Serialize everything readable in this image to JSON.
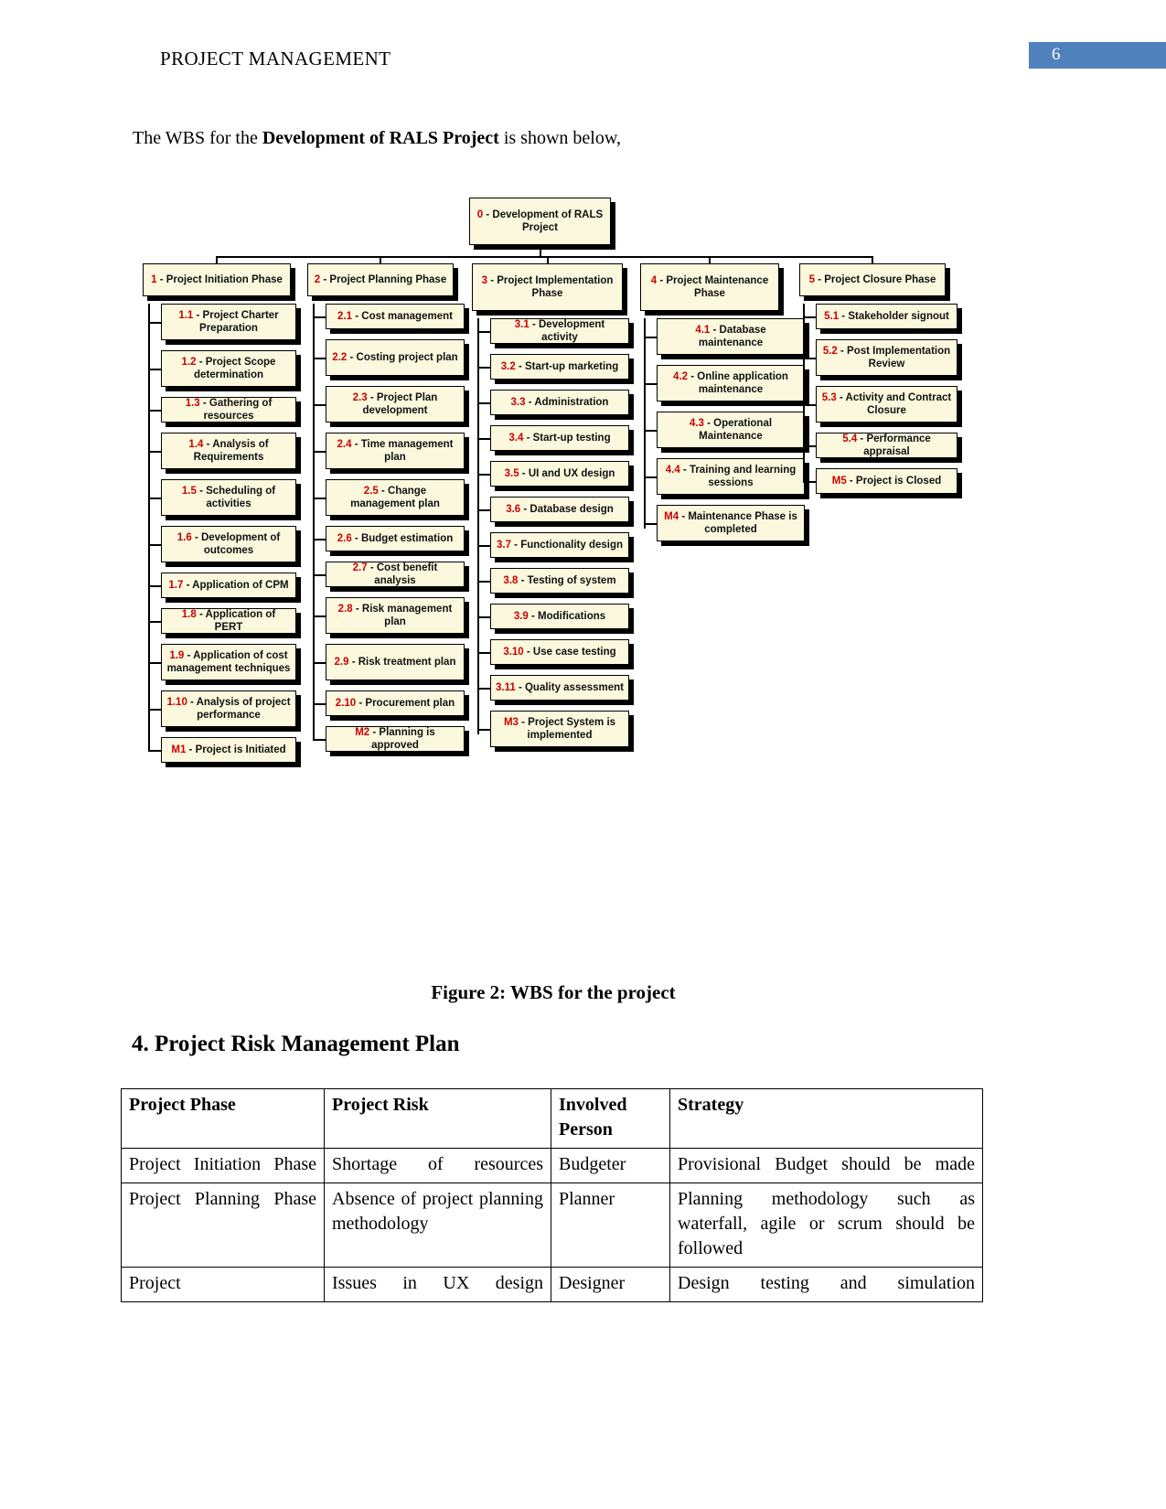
{
  "header": {
    "title": "PROJECT MANAGEMENT",
    "page_number": "6",
    "accent_color": "#4f81bd"
  },
  "intro": {
    "prefix": "The WBS for the ",
    "bold": "Development of RALS Project",
    "suffix": " is shown below,"
  },
  "figure": {
    "caption": "Figure 2: WBS for the project",
    "node_fill_color": "#fbf8dd",
    "code_color": "#cc0000"
  },
  "wbs": {
    "root": {
      "code": "0",
      "label": "- Development of RALS Project"
    },
    "columns": [
      {
        "phase": {
          "code": "1",
          "label": "- Project Initiation Phase"
        },
        "children": [
          {
            "code": "1.1",
            "label": "- Project Charter Preparation"
          },
          {
            "code": "1.2",
            "label": "- Project Scope determination"
          },
          {
            "code": "1.3",
            "label": "- Gathering of resources"
          },
          {
            "code": "1.4",
            "label": "   - Analysis of Requirements"
          },
          {
            "code": "1.5",
            "label": "- Scheduling of activities"
          },
          {
            "code": "1.6",
            "label": "- Development of outcomes"
          },
          {
            "code": "1.7",
            "label": "- Application of CPM"
          },
          {
            "code": "1.8",
            "label": "- Application of PERT"
          },
          {
            "code": "1.9",
            "label": "    - Application of cost management techniques"
          },
          {
            "code": "1.10",
            "label": "- Analysis of project performance"
          },
          {
            "code": "M1",
            "label": "- Project is Initiated"
          }
        ]
      },
      {
        "phase": {
          "code": "2",
          "label": "- Project Planning Phase"
        },
        "children": [
          {
            "code": "2.1",
            "label": "- Cost management"
          },
          {
            "code": "2.2",
            "label": "- Costing project plan"
          },
          {
            "code": "2.3",
            "label": "- Project Plan development"
          },
          {
            "code": "2.4",
            "label": "- Time management plan"
          },
          {
            "code": "2.5",
            "label": "- Change management plan"
          },
          {
            "code": "2.6",
            "label": "- Budget estimation"
          },
          {
            "code": "2.7",
            "label": "- Cost benefit analysis"
          },
          {
            "code": "2.8",
            "label": "- Risk management plan"
          },
          {
            "code": "2.9",
            "label": "- Risk treatment plan"
          },
          {
            "code": "2.10",
            "label": "- Procurement plan"
          },
          {
            "code": "M2",
            "label": "- Planning is approved"
          }
        ]
      },
      {
        "phase": {
          "code": "3",
          "label": "- Project Implementation Phase"
        },
        "children": [
          {
            "code": "3.1",
            "label": "- Development activity"
          },
          {
            "code": "3.2",
            "label": "- Start-up marketing"
          },
          {
            "code": "3.3",
            "label": "- Administration"
          },
          {
            "code": "3.4",
            "label": "- Start-up testing"
          },
          {
            "code": "3.5",
            "label": "- UI and UX design"
          },
          {
            "code": "3.6",
            "label": "- Database design"
          },
          {
            "code": "3.7",
            "label": "- Functionality design"
          },
          {
            "code": "3.8",
            "label": "- Testing of system"
          },
          {
            "code": "3.9",
            "label": "- Modifications"
          },
          {
            "code": "3.10",
            "label": "- Use case testing"
          },
          {
            "code": "3.11",
            "label": "- Quality assessment"
          },
          {
            "code": "M3",
            "label": "- Project System is implemented"
          }
        ]
      },
      {
        "phase": {
          "code": "4",
          "label": "- Project Maintenance Phase"
        },
        "children": [
          {
            "code": "4.1",
            "label": "- Database maintenance"
          },
          {
            "code": "4.2",
            "label": " - Online application maintenance"
          },
          {
            "code": "4.3",
            "label": "- Operational Maintenance"
          },
          {
            "code": "4.4",
            "label": "- Training and learning sessions"
          },
          {
            "code": "M4",
            "label": " - Maintenance Phase is completed"
          }
        ]
      },
      {
        "phase": {
          "code": "5",
          "label": "- Project Closure Phase"
        },
        "children": [
          {
            "code": "5.1",
            "label": "- Stakeholder signout"
          },
          {
            "code": "5.2",
            "label": " - Post Implementation Review"
          },
          {
            "code": "5.3",
            "label": " - Activity and Contract Closure"
          },
          {
            "code": "5.4",
            "label": "- Performance appraisal"
          },
          {
            "code": "M5",
            "label": "- Project is Closed"
          }
        ]
      }
    ]
  },
  "section": {
    "heading": "4. Project Risk Management Plan"
  },
  "risk_table": {
    "headers": [
      "Project Phase",
      "Project Risk",
      "Involved Person",
      "Strategy"
    ],
    "rows": [
      {
        "phase": "Project Initiation Phase",
        "risk": "Shortage of resources",
        "person": "Budgeter",
        "strategy": "Provisional Budget should be made"
      },
      {
        "phase": "Project Planning Phase",
        "risk": "Absence of project planning methodology",
        "person": "Planner",
        "strategy": "Planning methodology such as waterfall, agile or scrum should be followed"
      },
      {
        "phase": "Project",
        "risk": "Issues in UX design",
        "person": "Designer",
        "strategy": "Design testing and simulation"
      }
    ]
  }
}
